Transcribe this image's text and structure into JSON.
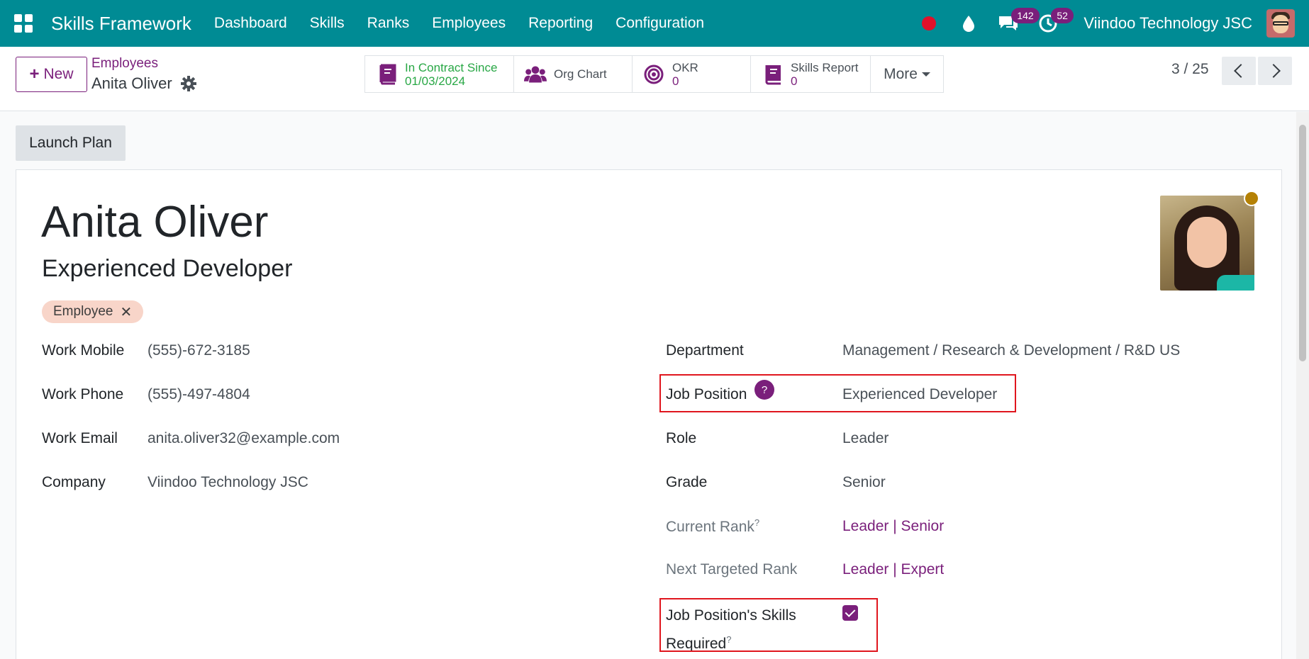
{
  "navbar": {
    "brand": "Skills Framework",
    "menu": [
      "Dashboard",
      "Skills",
      "Ranks",
      "Employees",
      "Reporting",
      "Configuration"
    ],
    "messages_count": "142",
    "activities_count": "52",
    "company": "Viindoo Technology JSC",
    "icons": [
      "apps-grid-icon",
      "recording-dot-icon",
      "water-drop-icon",
      "chat-icon",
      "clock-icon"
    ]
  },
  "control": {
    "new_label": "New",
    "breadcrumb_parent": "Employees",
    "breadcrumb_current": "Anita Oliver",
    "smart_buttons": [
      {
        "label": "In Contract Since",
        "value": "01/03/2024"
      },
      {
        "label": "Org Chart",
        "value": ""
      },
      {
        "label": "OKR",
        "value": "0"
      },
      {
        "label": "Skills Report",
        "value": "0"
      }
    ],
    "more_label": "More",
    "pager": "3 / 25"
  },
  "launch_plan_label": "Launch Plan",
  "employee": {
    "name": "Anita Oliver",
    "job_title": "Experienced Developer",
    "tag": "Employee",
    "left_fields": [
      {
        "label": "Work Mobile",
        "value": "(555)-672-3185"
      },
      {
        "label": "Work Phone",
        "value": "(555)-497-4804"
      },
      {
        "label": "Work Email",
        "value": "anita.oliver32@example.com"
      },
      {
        "label": "Company",
        "value": "Viindoo Technology JSC"
      }
    ],
    "department": {
      "label": "Department",
      "value": "Management / Research & Development / R&D US"
    },
    "job_position": {
      "label": "Job Position",
      "help": "?",
      "value": "Experienced Developer"
    },
    "role": {
      "label": "Role",
      "value": "Leader"
    },
    "grade": {
      "label": "Grade",
      "value": "Senior"
    },
    "current_rank": {
      "label": "Current Rank",
      "sup": "?",
      "value": "Leader | Senior"
    },
    "next_rank": {
      "label": "Next Targeted Rank",
      "value": "Leader | Expert"
    },
    "skills_required": {
      "label_line1": "Job Position's Skills",
      "label_line2": "Required",
      "sup": "?",
      "checked": true
    }
  },
  "colors": {
    "navbar": "#008b94",
    "accent": "#7a1f7b",
    "highlight": "#e0161e",
    "contract_green": "#28a745",
    "tag_bg": "#f8d5c9"
  }
}
